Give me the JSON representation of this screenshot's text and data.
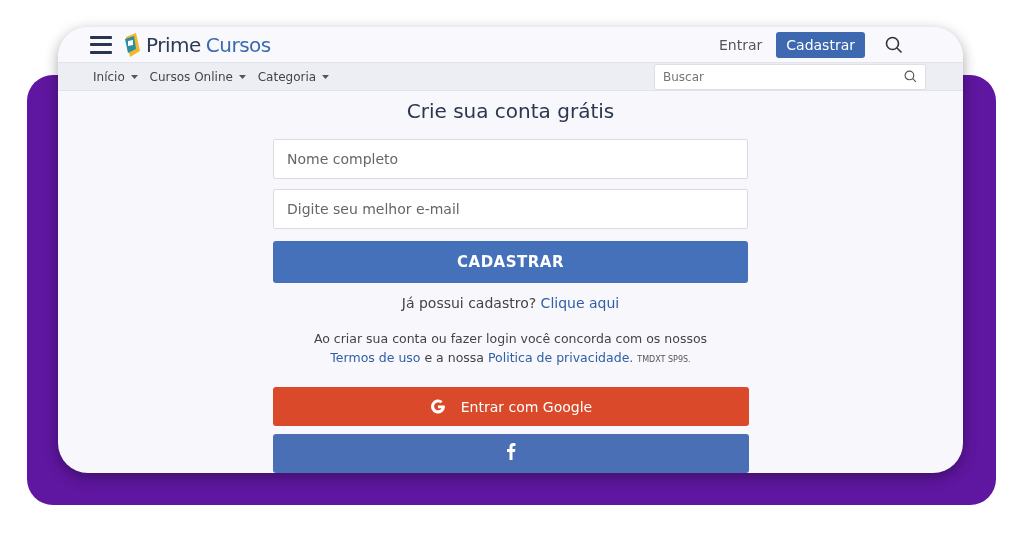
{
  "header": {
    "logo_text": "Prime",
    "logo_accent": "Cursos",
    "login_link": "Entrar",
    "signup_button": "Cadastrar"
  },
  "nav": {
    "items": [
      {
        "label": "Início"
      },
      {
        "label": "Cursos Online"
      },
      {
        "label": "Categoria"
      }
    ],
    "search": {
      "placeholder": "Buscar"
    }
  },
  "form": {
    "title": "Crie sua conta grátis",
    "fields": [
      {
        "placeholder": "Nome completo"
      },
      {
        "placeholder": "Digite seu melhor e-mail"
      }
    ],
    "submit": "CADASTRAR",
    "login_prompt": "Já possui cadastro?",
    "login_link": "Clique aqui",
    "terms_before": "Ao criar sua conta ou fazer login você concorda com os nossos",
    "terms_link": "Termos de uso",
    "terms_middle": "e a nossa",
    "privacy_link": "Politica de privacidade.",
    "terms_note": "TMDXT SP9S.",
    "social": [
      {
        "kind": "google",
        "label": "Entrar com Google"
      },
      {
        "kind": "facebook"
      }
    ]
  }
}
